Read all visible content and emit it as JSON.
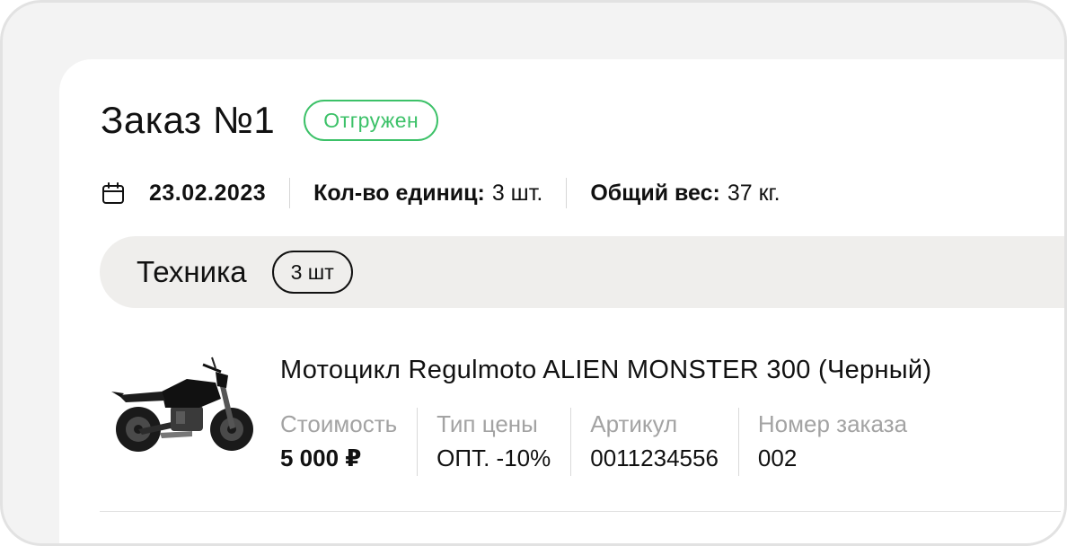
{
  "order": {
    "title": "Заказ №1",
    "status": "Отгружен",
    "date": "23.02.2023",
    "units_label": "Кол-во единиц:",
    "units_value": "3 шт.",
    "weight_label": "Общий вес:",
    "weight_value": "37 кг."
  },
  "section": {
    "title": "Техника",
    "count": "3 шт"
  },
  "product": {
    "name": "Мотоцикл Regulmoto ALIEN MONSTER 300 (Черный)",
    "attributes": [
      {
        "label": "Стоимость",
        "value": "5 000 ₽"
      },
      {
        "label": "Тип цены",
        "value": "ОПТ. -10%"
      },
      {
        "label": "Артикул",
        "value": "0011234556"
      },
      {
        "label": "Номер заказа",
        "value": "002"
      }
    ]
  },
  "colors": {
    "status_green": "#3cc168",
    "section_bg": "#efeeec",
    "muted_text": "#a3a3a3"
  },
  "icons": [
    "calendar-icon",
    "motorcycle-image"
  ]
}
